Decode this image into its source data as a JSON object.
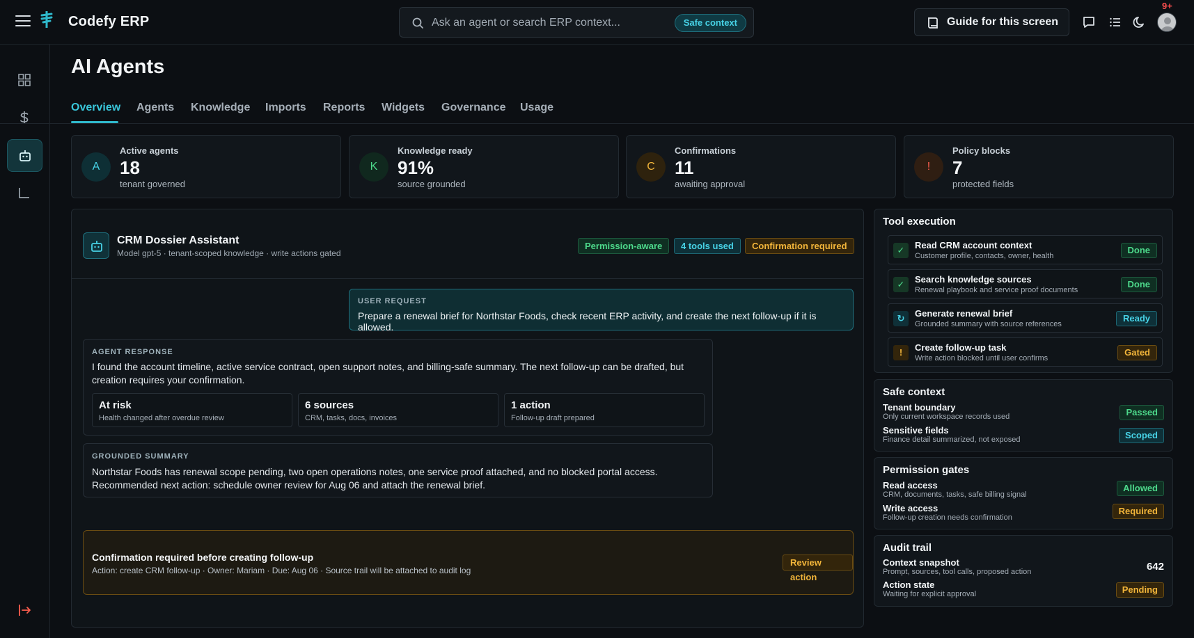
{
  "header": {
    "brand": "Codefy ERP",
    "search_placeholder": "Ask an agent or search ERP context...",
    "safe_context_pill": "Safe context",
    "guide_button": "Guide for this screen",
    "notification_count": "9+"
  },
  "page": {
    "title": "AI Agents",
    "tabs": [
      "Overview",
      "Agents",
      "Knowledge",
      "Imports",
      "Reports",
      "Widgets",
      "Governance",
      "Usage"
    ],
    "active_tab": "Overview"
  },
  "stats": [
    {
      "initial": "A",
      "label": "Active agents",
      "value": "18",
      "sub": "tenant governed",
      "color": "#47d2e6"
    },
    {
      "initial": "K",
      "label": "Knowledge ready",
      "value": "91%",
      "sub": "source grounded",
      "color": "#4dd98b"
    },
    {
      "initial": "C",
      "label": "Confirmations",
      "value": "11",
      "sub": "awaiting approval",
      "color": "#f2b53a"
    },
    {
      "initial": "!",
      "label": "Policy blocks",
      "value": "7",
      "sub": "protected fields",
      "color": "#ff5f4f"
    }
  ],
  "assistant": {
    "title": "CRM Dossier Assistant",
    "subtitle": "Model gpt-5 · tenant-scoped knowledge · write actions gated",
    "badges": [
      "Permission-aware",
      "4 tools used",
      "Confirmation required"
    ],
    "user_request": {
      "label": "USER REQUEST",
      "text": "Prepare a renewal brief for Northstar Foods, check recent ERP activity, and create the next follow-up if it is allowed."
    },
    "agent_response": {
      "label": "AGENT RESPONSE",
      "text": "I found the account timeline, active service contract, open support notes, and billing-safe summary. The next follow-up can be drafted, but creation requires your confirmation.",
      "metrics": [
        {
          "value": "At risk",
          "sub": "Health changed after overdue review"
        },
        {
          "value": "6 sources",
          "sub": "CRM, tasks, docs, invoices"
        },
        {
          "value": "1 action",
          "sub": "Follow-up draft prepared"
        }
      ]
    },
    "grounded_summary": {
      "label": "GROUNDED SUMMARY",
      "text": "Northstar Foods has renewal scope pending, two open operations notes, one service proof attached, and no blocked portal access. Recommended next action: schedule owner review for Aug 06 and attach the renewal brief."
    },
    "confirmation": {
      "title": "Confirmation required before creating follow-up",
      "detail": "Action: create CRM follow-up · Owner: Mariam · Due: Aug 06 · Source trail will be attached to audit log",
      "button": "Review action"
    }
  },
  "tool_execution": {
    "title": "Tool execution",
    "items": [
      {
        "icon": "check-icon",
        "glyph": "✓",
        "title": "Read CRM account context",
        "sub": "Customer profile, contacts, owner, health",
        "status": "Done"
      },
      {
        "icon": "check-icon",
        "glyph": "✓",
        "title": "Search knowledge sources",
        "sub": "Renewal playbook and service proof documents",
        "status": "Done"
      },
      {
        "icon": "refresh-icon",
        "glyph": "↻",
        "title": "Generate renewal brief",
        "sub": "Grounded summary with source references",
        "status": "Ready"
      },
      {
        "icon": "warning-icon",
        "glyph": "!",
        "title": "Create follow-up task",
        "sub": "Write action blocked until user confirms",
        "status": "Gated"
      }
    ]
  },
  "safe_context": {
    "title": "Safe context",
    "rows": [
      {
        "title": "Tenant boundary",
        "sub": "Only current workspace records used",
        "status": "Passed"
      },
      {
        "title": "Sensitive fields",
        "sub": "Finance detail summarized, not exposed",
        "status": "Scoped"
      }
    ]
  },
  "permission_gates": {
    "title": "Permission gates",
    "rows": [
      {
        "title": "Read access",
        "sub": "CRM, documents, tasks, safe billing signal",
        "status": "Allowed"
      },
      {
        "title": "Write access",
        "sub": "Follow-up creation needs confirmation",
        "status": "Required"
      }
    ]
  },
  "audit_trail": {
    "title": "Audit trail",
    "rows": [
      {
        "title": "Context snapshot",
        "sub": "Prompt, sources, tool calls, proposed action",
        "value": "642"
      },
      {
        "title": "Action state",
        "sub": "Waiting for explicit approval",
        "status": "Pending"
      }
    ]
  }
}
